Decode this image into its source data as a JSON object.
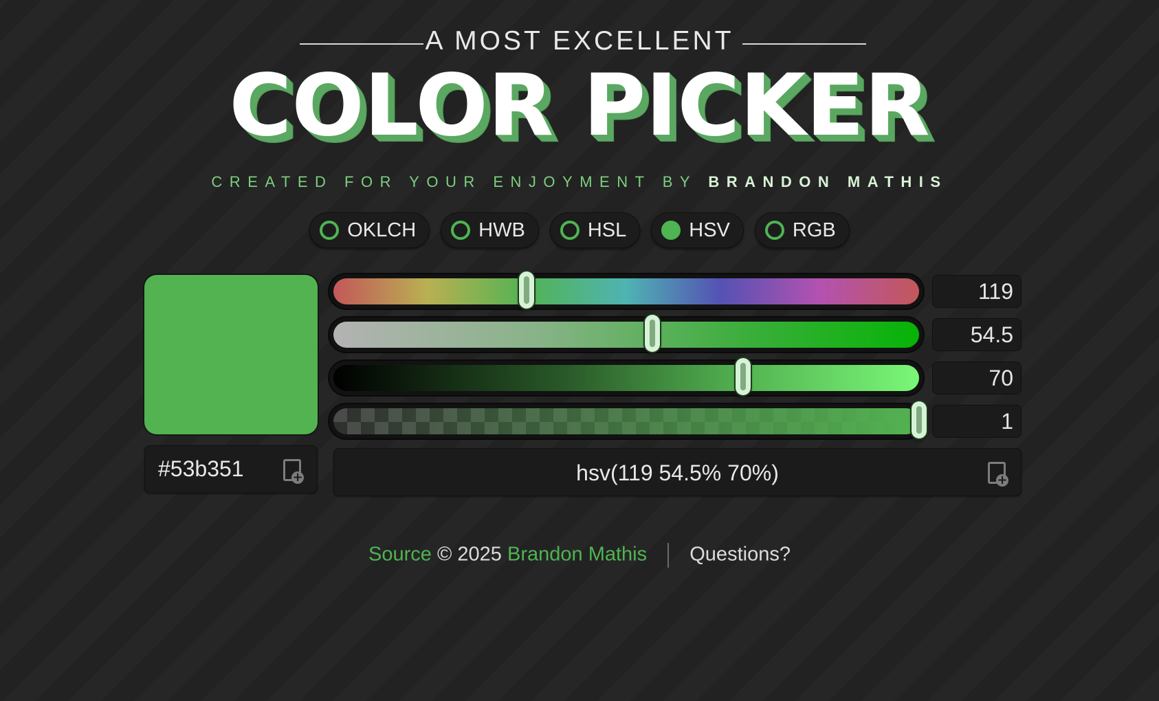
{
  "header": {
    "pretitle": "A MOST EXCELLENT",
    "title": "COLOR PICKER",
    "byline_prefix": "CREATED FOR YOUR ENJOYMENT BY",
    "byline_author": "BRANDON MATHIS"
  },
  "modes": [
    {
      "label": "OKLCH",
      "selected": false
    },
    {
      "label": "HWB",
      "selected": false
    },
    {
      "label": "HSL",
      "selected": false
    },
    {
      "label": "HSV",
      "selected": true
    },
    {
      "label": "RGB",
      "selected": false
    }
  ],
  "color": {
    "hex": "#53b351",
    "css": "hsv(119 54.5% 70%)"
  },
  "sliders": {
    "hue": {
      "value": "119",
      "fraction": 0.33
    },
    "saturation": {
      "value": "54.5",
      "fraction": 0.545
    },
    "value": {
      "value": "70",
      "fraction": 0.7
    },
    "alpha": {
      "value": "1",
      "fraction": 1.0
    }
  },
  "icons": {
    "copy_hex": "copy-icon",
    "copy_css": "copy-icon"
  },
  "footer": {
    "source": "Source",
    "copyright": "© 2025",
    "author": "Brandon Mathis",
    "questions": "Questions?"
  },
  "colors": {
    "accent": "#4fb452",
    "swatch": "#53b351",
    "background": "#242424"
  }
}
